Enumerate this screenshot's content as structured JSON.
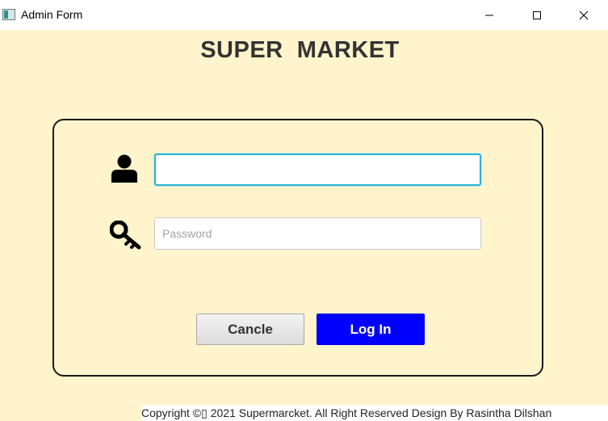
{
  "window": {
    "title": "Admin Form",
    "minimize_icon": "minimize-icon",
    "maximize_icon": "maximize-icon",
    "close_icon": "close-icon"
  },
  "main": {
    "heading": "SUPER  MARKET"
  },
  "form": {
    "username": {
      "value": "",
      "placeholder": "",
      "icon": "user-icon"
    },
    "password": {
      "value": "",
      "placeholder": "Password",
      "icon": "key-icon"
    },
    "cancel_label": "Cancle",
    "login_label": "Log In"
  },
  "footer": {
    "text": "Copyright ©▯ 2021 Supermarcket. All Right Reserved Design By Rasintha Dilshan"
  },
  "colors": {
    "background": "#fff4cc",
    "login_button": "#0000ff",
    "focus_border": "#2bb3d1"
  }
}
